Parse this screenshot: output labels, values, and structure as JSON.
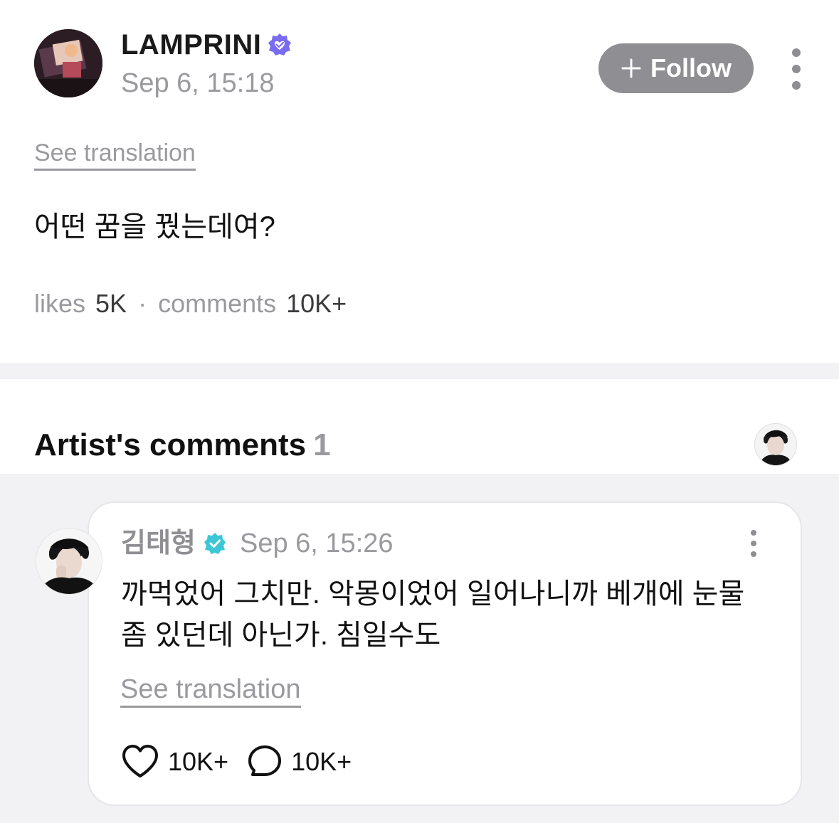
{
  "post": {
    "author": "LAMPRINI",
    "time": "Sep 6, 15:18",
    "follow_label": "Follow",
    "see_translation": "See translation",
    "body": "어떤 꿈을 꿨는데여?",
    "likes_label": "likes",
    "likes_count": "5K",
    "separator": "·",
    "comments_label": "comments",
    "comments_count": "10K+"
  },
  "artist_comments": {
    "title": "Artist's comments",
    "count": "1",
    "comment": {
      "author": "김태형",
      "time": "Sep 6, 15:26",
      "text": "까먹었어 그치만. 악몽이었어 일어나니까 베개에 눈물좀 있던데 아닌가. 침일수도",
      "see_translation": "See translation",
      "likes": "10K+",
      "replies": "10K+"
    }
  },
  "colors": {
    "follow_bg": "#8e8e93",
    "verified_purple": "#7a6cf0",
    "verified_teal": "#3cc6d6",
    "muted_text": "#9a9a9e",
    "section_bg": "#f2f2f4"
  },
  "icons": [
    "verified-badge-icon",
    "plus-icon",
    "more-vertical-icon",
    "heart-icon",
    "comment-bubble-icon"
  ]
}
